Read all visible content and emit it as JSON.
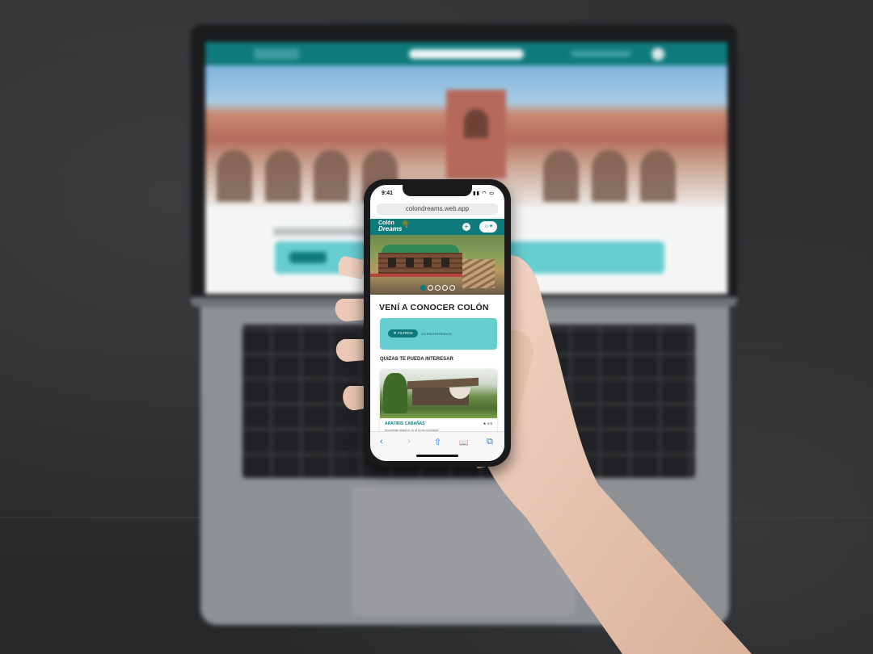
{
  "phone": {
    "status_time": "9:41",
    "status_icons": "▮▮ ◠ ▭",
    "url": "colondreams.web.app",
    "app": {
      "logo_line1": "Colón",
      "logo_line2": "Dreams",
      "plus_icon": "+",
      "user_icon": "☺▾"
    },
    "carousel": {
      "slides": 5,
      "active_index": 0
    },
    "title": "VENÍ A CONOCER COLÓN",
    "filter": {
      "button_label": "▼ FILTROS",
      "results_text": "0/0 ENCONTRADOS"
    },
    "section_title": "QUIZAS TE PUEDA INTERESAR",
    "card": {
      "name": "ARATIRIS CABAÑAS",
      "rating": "★ 4.6",
      "description": "Encontrate desde el 14 al 16 de noviembre",
      "favorite_icon": "♡"
    },
    "toolbar": {
      "back_icon": "‹",
      "forward_icon": "›",
      "share_icon": "⇧",
      "bookmarks_icon": "📖",
      "tabs_icon": "⧉"
    }
  },
  "colors": {
    "brand_teal": "#0f7a7b",
    "filter_bg": "#66cdd0",
    "ios_blue": "#2f7bd8"
  }
}
